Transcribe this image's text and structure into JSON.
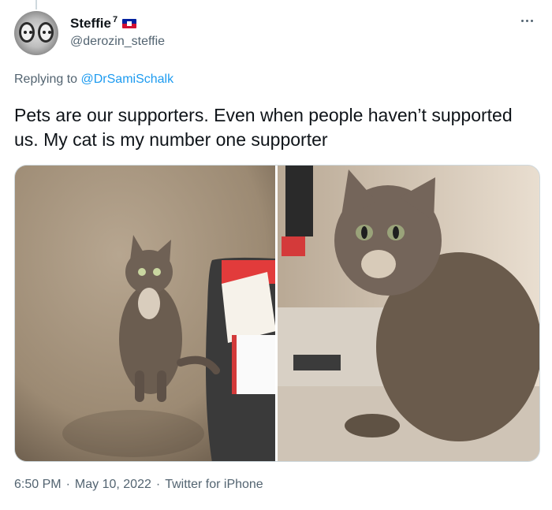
{
  "user": {
    "display_name": "Steffie",
    "name_superscript": "7",
    "handle": "@derozin_steffie"
  },
  "reply": {
    "prefix": "Replying to",
    "mention": "@DrSamiSchalk"
  },
  "tweet": {
    "text": "Pets are our supporters. Even when people haven’t supported us. My cat is my number one supporter"
  },
  "meta": {
    "time": "6:50 PM",
    "separator": "·",
    "date": "May 10, 2022",
    "source": "Twitter for iPhone"
  },
  "icons": {
    "more": "more-horizontal-icon",
    "flag": "haiti-flag-icon"
  },
  "colors": {
    "text_primary": "#0f1419",
    "text_secondary": "#536471",
    "link": "#1d9bf0",
    "border": "#cfd9de"
  }
}
